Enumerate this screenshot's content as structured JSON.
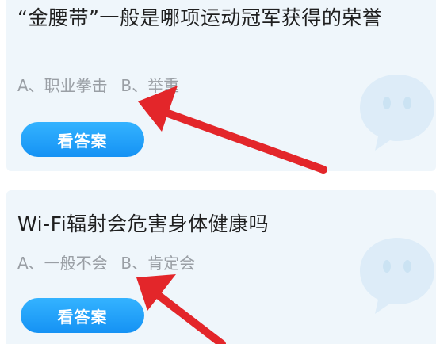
{
  "questions": [
    {
      "text": "“金腰带”一般是哪项运动冠军获得的荣誉",
      "option_a": "A、职业拳击",
      "option_b": "B、举重",
      "button_label": "看答案"
    },
    {
      "text": "Wi-Fi辐射会危害身体健康吗",
      "option_a": "A、一般不会",
      "option_b": "B、肯定会",
      "button_label": "看答案"
    }
  ],
  "colors": {
    "card_background": "#eff6fb",
    "button": "#1a9af7",
    "arrow": "#e3262a",
    "question_text": "#1f1f1f",
    "option_text": "#9a9fa5"
  },
  "icons": [
    "chat-bubble-mascot-icon",
    "red-arrow-annotation"
  ]
}
